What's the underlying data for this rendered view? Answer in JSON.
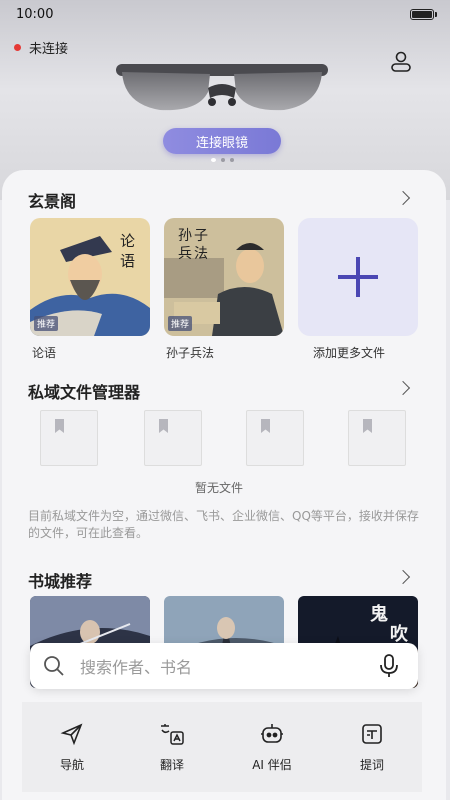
{
  "status": {
    "time": "10:00"
  },
  "device": {
    "connection_status": "未连接",
    "connect_button": "连接眼镜"
  },
  "library": {
    "title": "玄景阁",
    "books": [
      {
        "title": "论语",
        "cover_text": "论语",
        "tag": "推荐"
      },
      {
        "title": "孙子兵法",
        "cover_text": "孙子兵法",
        "tag": "推荐"
      }
    ],
    "add_label": "添加更多文件"
  },
  "private_files": {
    "title": "私域文件管理器",
    "empty_label": "暂无文件",
    "description": "目前私域文件为空，通过微信、飞书、企业微信、QQ等平台，接收并保存的文件，可在此查看。"
  },
  "bookstore": {
    "title": "书城推荐",
    "cover_text_3": "鬼吹灯"
  },
  "search": {
    "placeholder": "搜索作者、书名"
  },
  "nav": [
    {
      "label": "导航",
      "icon": "paper-plane-icon"
    },
    {
      "label": "翻译",
      "icon": "translate-icon"
    },
    {
      "label": "AI 伴侣",
      "icon": "robot-icon"
    },
    {
      "label": "提词",
      "icon": "prompter-icon"
    }
  ]
}
